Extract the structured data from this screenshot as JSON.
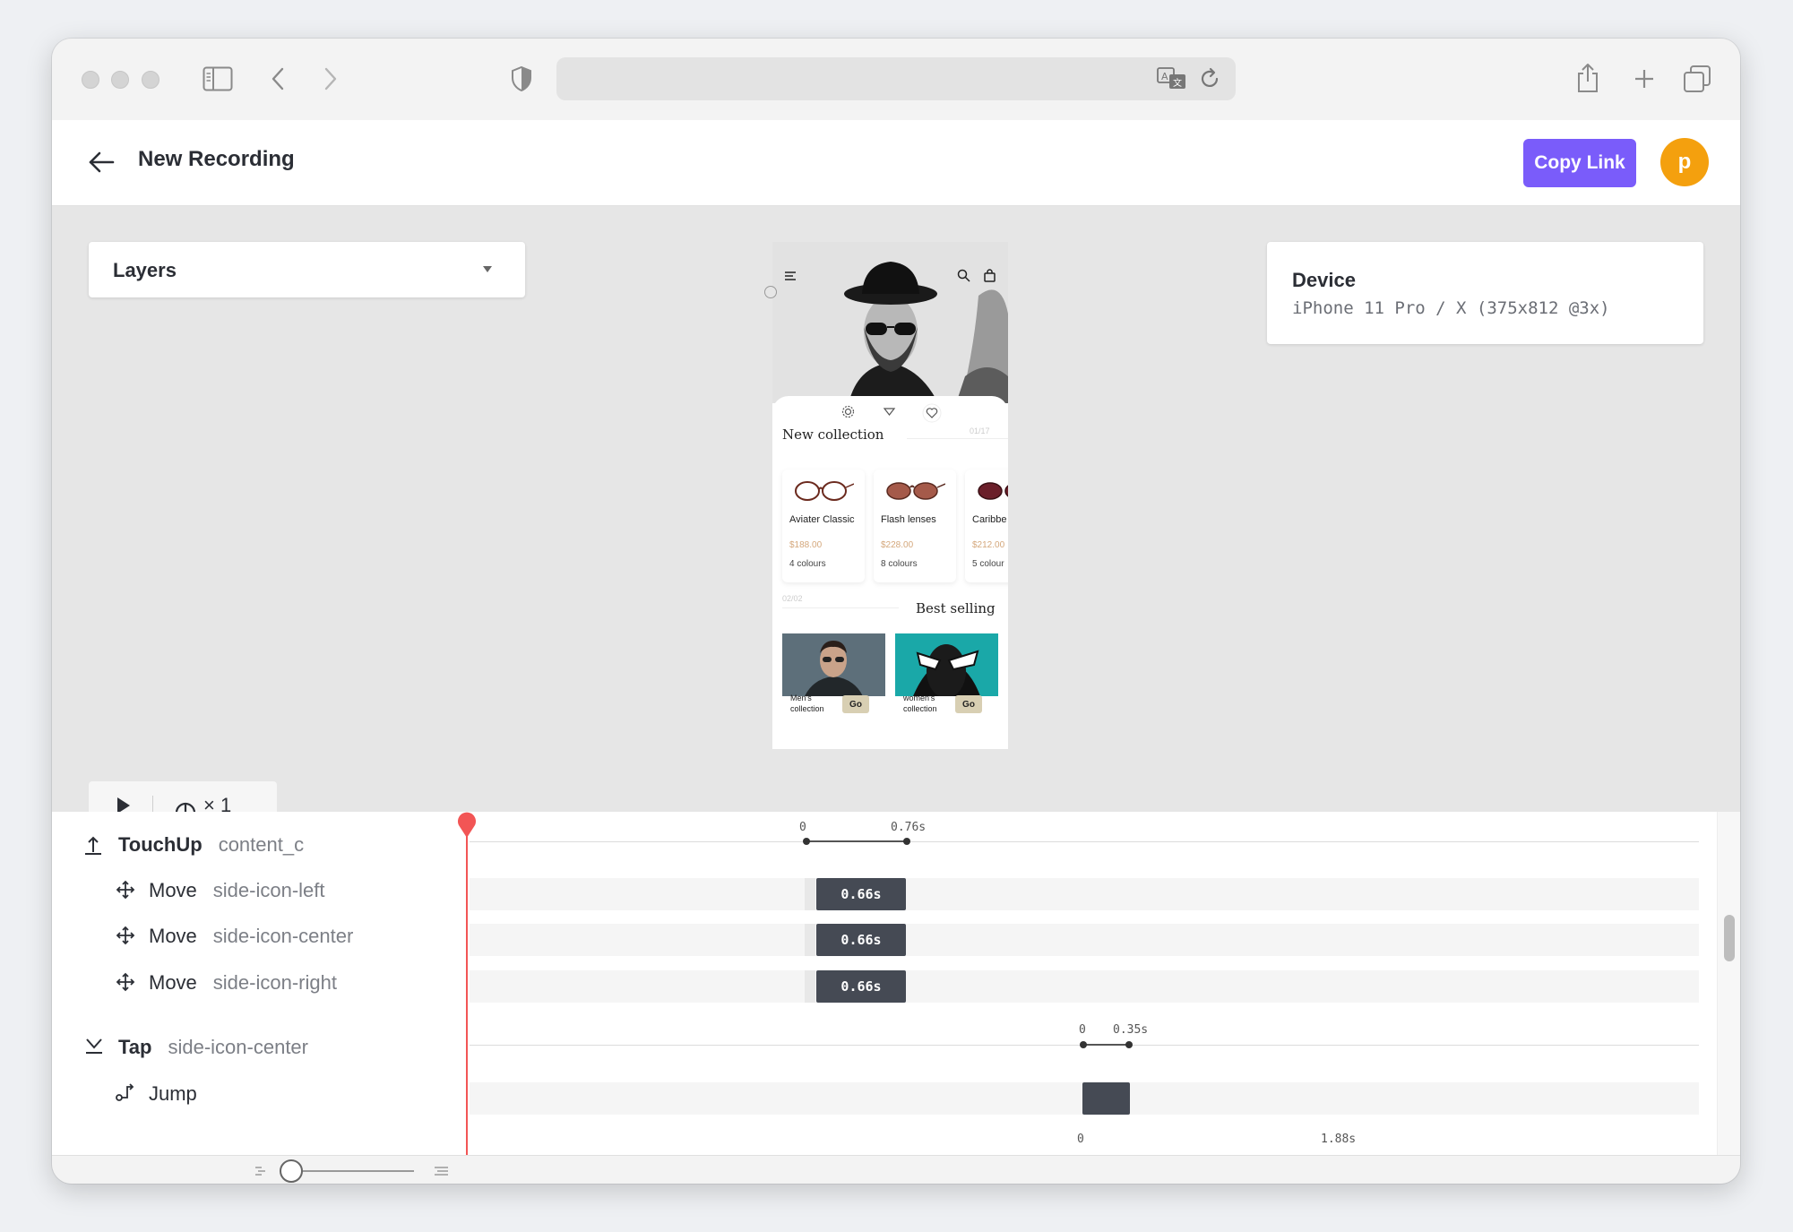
{
  "header": {
    "title": "New Recording",
    "copy_link": "Copy Link",
    "avatar_initial": "p"
  },
  "layers": {
    "label": "Layers"
  },
  "device": {
    "title": "Device",
    "value": "iPhone 11 Pro / X (375x812 @3x)"
  },
  "playback": {
    "speed": "× 1"
  },
  "phone": {
    "section_title": "New collection",
    "page_indicator": "01/17",
    "products": [
      {
        "name": "Aviater Classic",
        "price": "$188.00",
        "colours": "4 colours"
      },
      {
        "name": "Flash lenses",
        "price": "$228.00",
        "colours": "8 colours"
      },
      {
        "name": "Caribbe",
        "price": "$212.00",
        "colours": "5 colour"
      }
    ],
    "best_indicator": "02/02",
    "best_title": "Best selling",
    "collections": [
      {
        "label": "Men's collection",
        "go": "Go"
      },
      {
        "label": "women's collection",
        "go": "Go"
      }
    ]
  },
  "timeline": {
    "events": [
      {
        "type": "TouchUp",
        "target": "content_c"
      },
      {
        "type": "Move",
        "target": "side-icon-left",
        "duration": "0.66s"
      },
      {
        "type": "Move",
        "target": "side-icon-center",
        "duration": "0.66s"
      },
      {
        "type": "Move",
        "target": "side-icon-right",
        "duration": "0.66s"
      },
      {
        "type": "Tap",
        "target": "side-icon-center"
      },
      {
        "type": "Jump",
        "target": ""
      }
    ],
    "axes": [
      {
        "start": "0",
        "end": "0.76s"
      },
      {
        "start": "0",
        "end": "0.35s"
      },
      {
        "start": "0",
        "end": "1.88s"
      }
    ]
  },
  "colors": {
    "accent": "#7a5cfa",
    "avatar": "#f4a00e",
    "playhead": "#f25555",
    "bar": "#454a54"
  }
}
